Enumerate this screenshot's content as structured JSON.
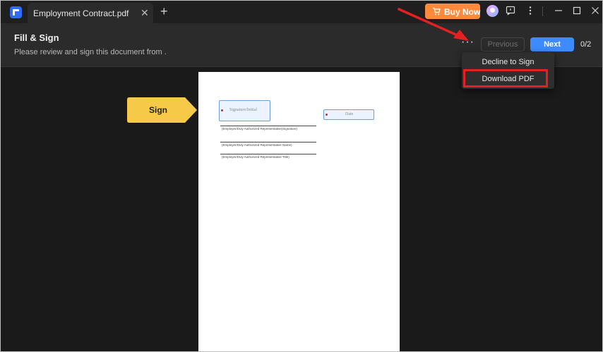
{
  "window": {
    "tab_title": "Employment Contract.pdf",
    "tab_close": "✕",
    "tab_add": "+",
    "buy_now": "Buy Now",
    "icons": [
      "cart-icon",
      "avatar",
      "feedback-icon",
      "more-vertical-icon",
      "minimize-icon",
      "maximize-icon",
      "close-icon"
    ]
  },
  "header": {
    "title": "Fill & Sign",
    "subtitle": "Please review and sign this document from ."
  },
  "toolbar": {
    "more_label": "···",
    "previous_label": "Previous",
    "next_label": "Next",
    "page_count": "0/2"
  },
  "menu": {
    "items": [
      {
        "label": "Decline to Sign"
      },
      {
        "label": "Download PDF"
      }
    ]
  },
  "document": {
    "signature_field": "Signature/Initial",
    "date_field": "Date",
    "lines": [
      "(Employer/Duly Authorized Representative(Signature)",
      "(Employer/Duly Authorized Representative Name)",
      "(Employer/Duly Authorized Representative Title)"
    ]
  },
  "sign_tag": {
    "label": "Sign"
  },
  "colors": {
    "accent": "#3d8bff",
    "buy_now": "#ff8a3d",
    "sign_tag": "#f7c948",
    "annotation": "#e52020"
  }
}
